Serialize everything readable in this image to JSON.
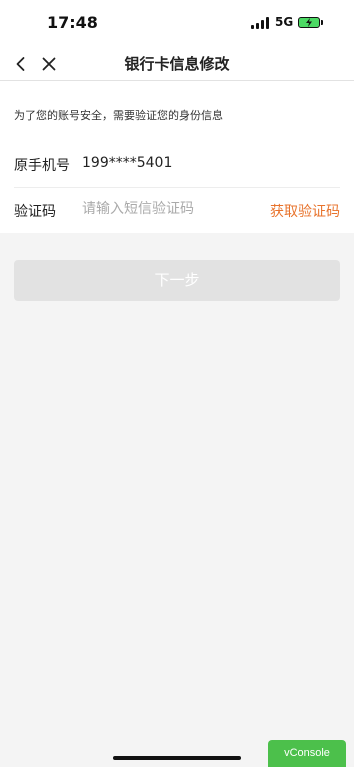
{
  "status_bar": {
    "time": "17:48",
    "network": "5G",
    "battery_color": "#4cd964"
  },
  "nav": {
    "title": "银行卡信息修改",
    "back_icon": "chevron-left-icon",
    "close_icon": "close-icon"
  },
  "form": {
    "hint": "为了您的账号安全，需要验证您的身份信息",
    "phone_label": "原手机号",
    "phone_value": "199****5401",
    "code_label": "验证码",
    "code_placeholder": "请输入短信验证码",
    "code_value": "",
    "get_code_label": "获取验证码"
  },
  "next_button": {
    "label": "下一步"
  },
  "vconsole": {
    "label": "vConsole"
  },
  "colors": {
    "accent": "#e8732c",
    "disabled_button": "#e2e2e2",
    "vconsole_green": "#4cc04b"
  }
}
